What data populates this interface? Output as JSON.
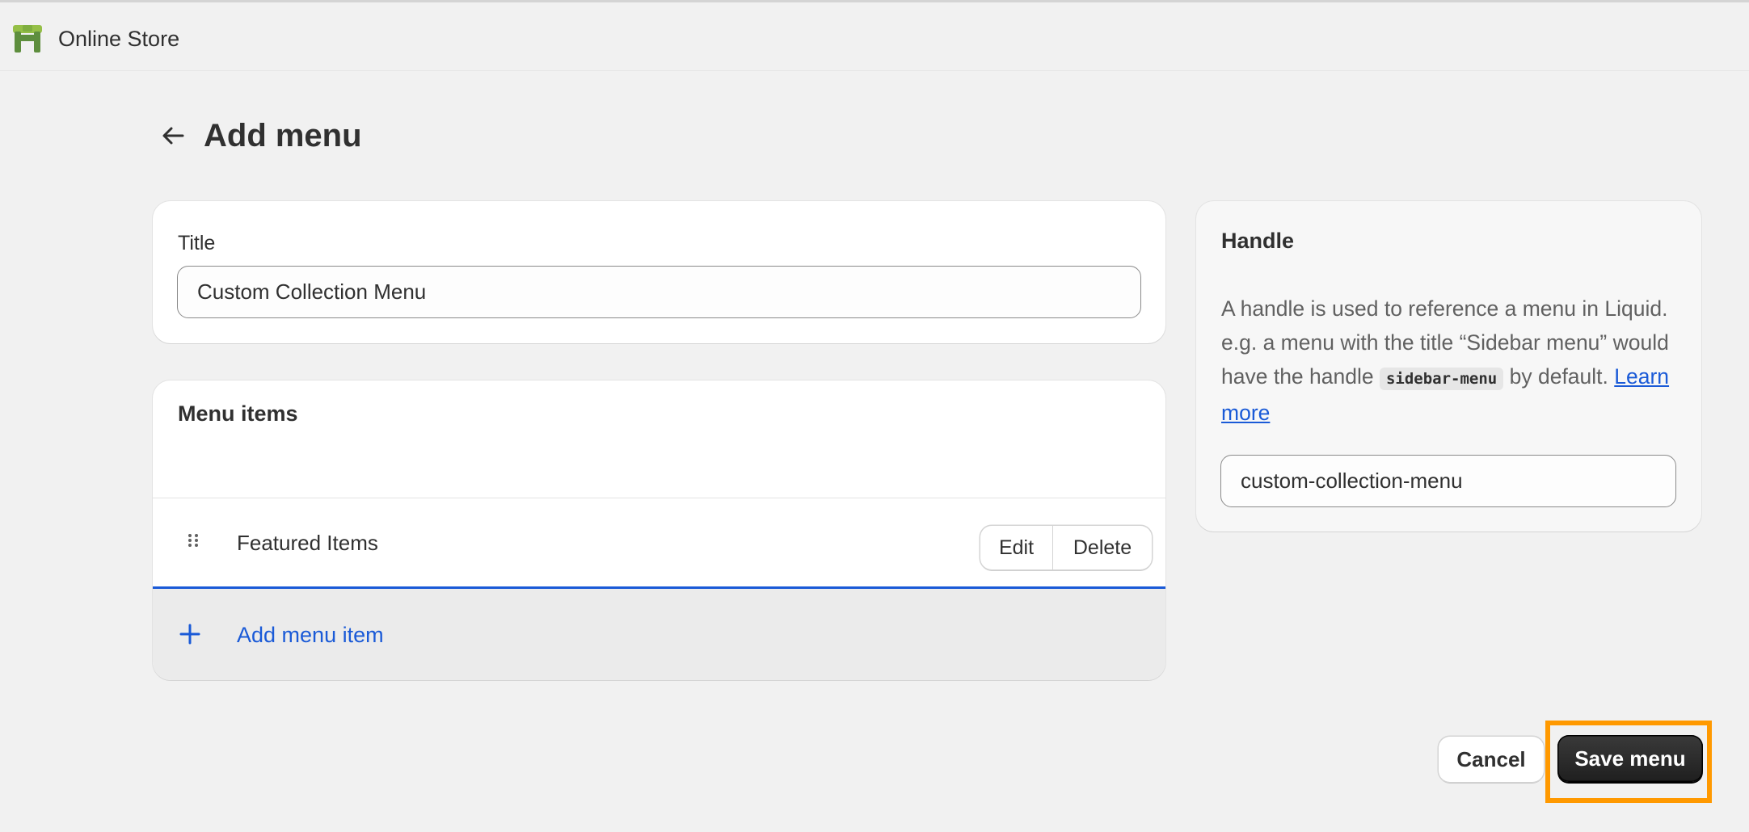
{
  "app": {
    "name": "Online Store",
    "logo_icon": "shopify-store-icon"
  },
  "header": {
    "back_icon": "arrow-left-icon",
    "title": "Add menu"
  },
  "title_card": {
    "label": "Title",
    "value": "Custom Collection Menu"
  },
  "menu_items_card": {
    "title": "Menu items",
    "items": [
      {
        "label": "Featured Items",
        "edit_label": "Edit",
        "delete_label": "Delete"
      }
    ],
    "add_label": "Add menu item"
  },
  "handle_card": {
    "title": "Handle",
    "desc_part1": "A handle is used to reference a menu in Liquid. e.g. a menu with the title “Sidebar menu” would have the handle ",
    "code": "sidebar-menu",
    "desc_part2": " by default. ",
    "learn_more": "Learn more",
    "value": "custom-collection-menu"
  },
  "footer": {
    "cancel_label": "Cancel",
    "save_label": "Save menu"
  },
  "colors": {
    "background": "#f1f1f1",
    "accent_link": "#1a5ad7",
    "primary_button": "#303030",
    "highlight": "#ff9900"
  }
}
